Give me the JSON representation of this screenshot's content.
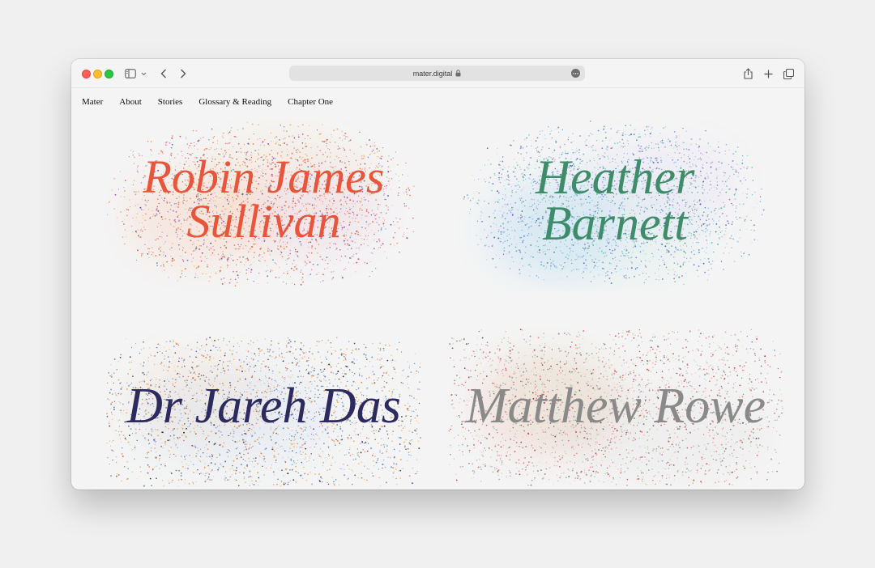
{
  "browser": {
    "url": "mater.digital"
  },
  "nav": {
    "items": [
      "Mater",
      "About",
      "Stories",
      "Glossary & Reading",
      "Chapter One"
    ]
  },
  "cards": [
    {
      "line1": "Robin James",
      "line2": "Sullivan",
      "color": "#e8553a"
    },
    {
      "line1": "Heather",
      "line2": "Barnett",
      "color": "#3f8c6b"
    },
    {
      "line1": "Dr Jareh Das",
      "line2": "",
      "color": "#2c2a5e"
    },
    {
      "line1": "Matthew Rowe",
      "line2": "",
      "color": "#8a8a8a"
    }
  ],
  "icons": {
    "sidebar": "sidebar-icon",
    "back": "chevron-left-icon",
    "forward": "chevron-right-icon",
    "share": "share-icon",
    "newtab": "plus-icon",
    "tabs": "tabs-icon",
    "lock": "lock-icon",
    "more": "more-icon"
  }
}
